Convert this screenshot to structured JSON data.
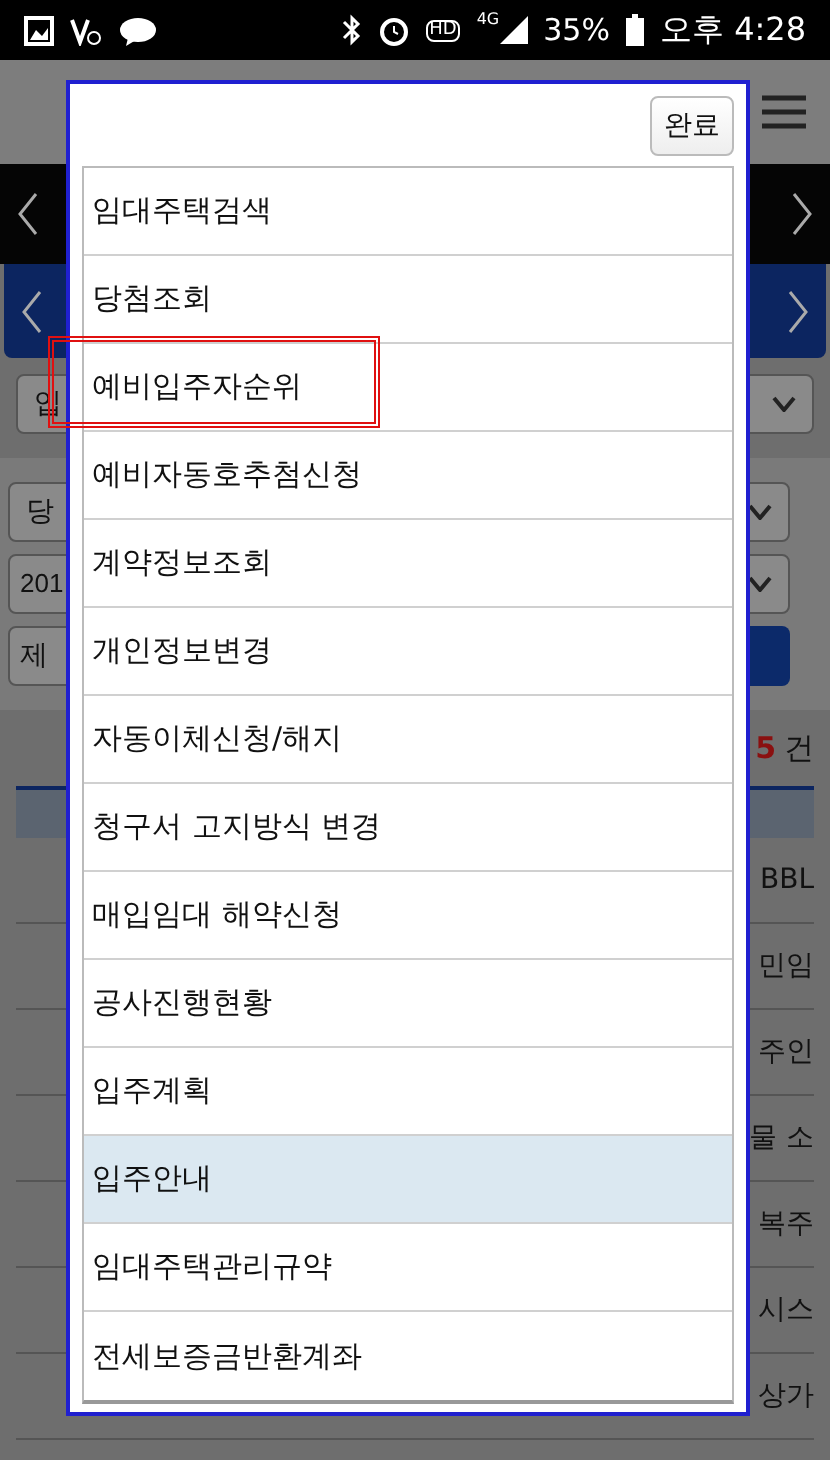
{
  "status_bar": {
    "hd": "HD",
    "network": "4G",
    "battery": "35%",
    "time": "오후 4:28"
  },
  "background": {
    "select_1": "입",
    "select_2": "당",
    "select_3": "201",
    "search_label": "제",
    "count_number": "5",
    "count_unit": "건",
    "rows": [
      {
        "right": "BBL"
      },
      {
        "right": "민임"
      },
      {
        "right": "주인"
      },
      {
        "right": "물 소"
      },
      {
        "right": "복주"
      },
      {
        "right": "시스"
      },
      {
        "right": "상가"
      }
    ]
  },
  "dialog": {
    "done_button": "완료",
    "items": [
      {
        "label": "임대주택검색",
        "selected": false,
        "highlighted": false
      },
      {
        "label": "당첨조회",
        "selected": false,
        "highlighted": false
      },
      {
        "label": "예비입주자순위",
        "selected": false,
        "highlighted": true
      },
      {
        "label": "예비자동호추첨신청",
        "selected": false,
        "highlighted": false
      },
      {
        "label": "계약정보조회",
        "selected": false,
        "highlighted": false
      },
      {
        "label": "개인정보변경",
        "selected": false,
        "highlighted": false
      },
      {
        "label": "자동이체신청/해지",
        "selected": false,
        "highlighted": false
      },
      {
        "label": "청구서 고지방식 변경",
        "selected": false,
        "highlighted": false
      },
      {
        "label": "매입임대 해약신청",
        "selected": false,
        "highlighted": false
      },
      {
        "label": "공사진행현황",
        "selected": false,
        "highlighted": false
      },
      {
        "label": "입주계획",
        "selected": false,
        "highlighted": false
      },
      {
        "label": "입주안내",
        "selected": true,
        "highlighted": false
      },
      {
        "label": "임대주택관리규약",
        "selected": false,
        "highlighted": false
      },
      {
        "label": "전세보증금반환계좌",
        "selected": false,
        "highlighted": false
      }
    ]
  }
}
